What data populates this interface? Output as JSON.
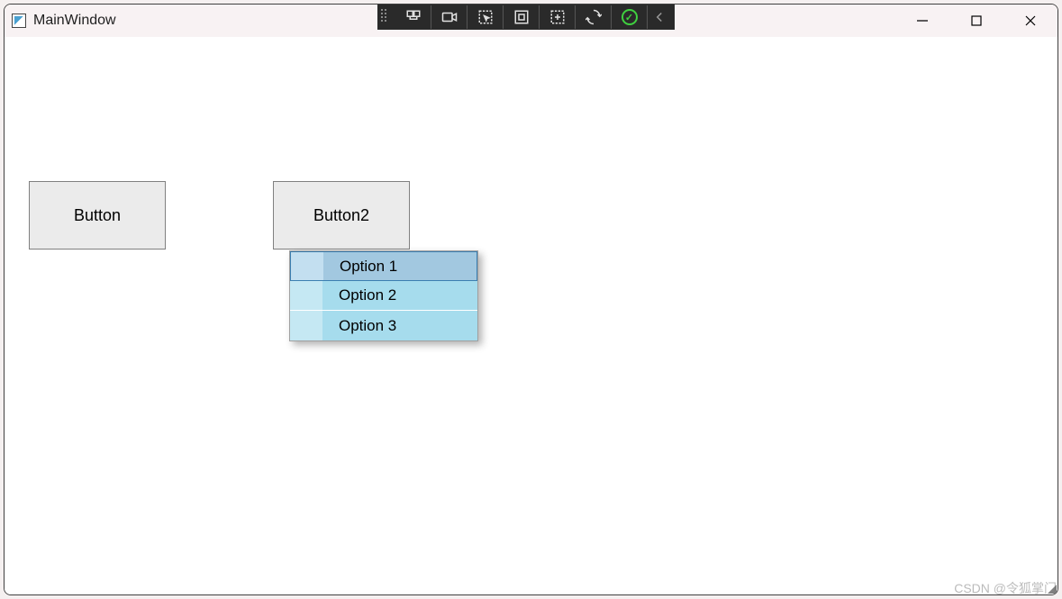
{
  "window": {
    "title": "MainWindow"
  },
  "buttons": {
    "button1": "Button",
    "button2": "Button2"
  },
  "menu": {
    "items": [
      {
        "label": "Option 1",
        "highlighted": true
      },
      {
        "label": "Option 2",
        "highlighted": false
      },
      {
        "label": "Option 3",
        "highlighted": false
      }
    ]
  },
  "watermark": "CSDN @令狐掌门"
}
